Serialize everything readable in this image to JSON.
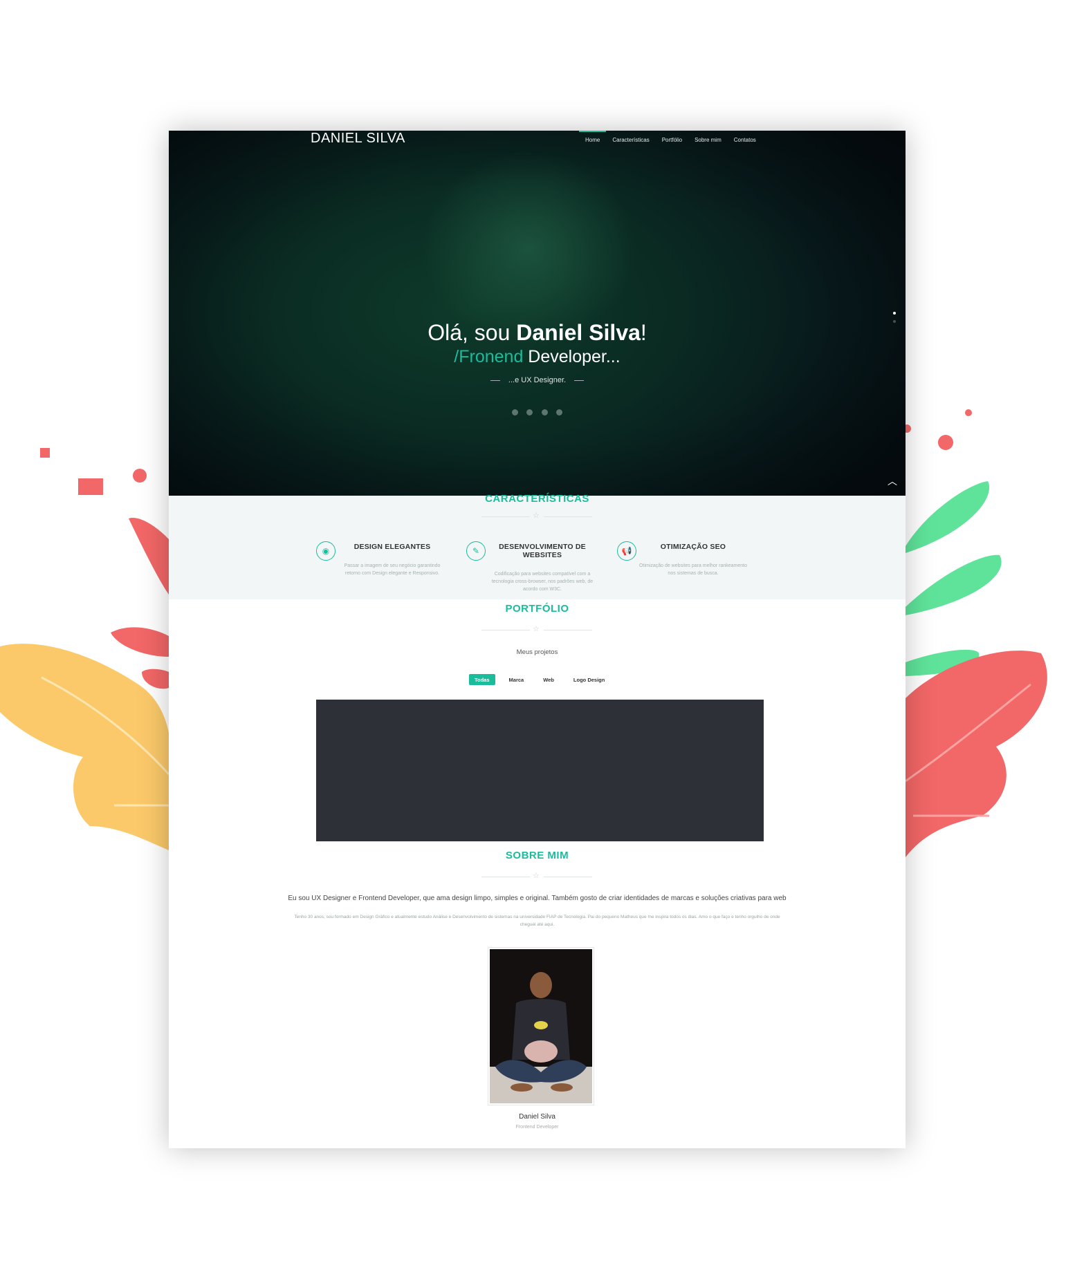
{
  "brand": "DANIEL SILVA",
  "nav": {
    "items": [
      {
        "label": "Home",
        "active": true
      },
      {
        "label": "Características",
        "active": false
      },
      {
        "label": "Portfólio",
        "active": false
      },
      {
        "label": "Sobre mim",
        "active": false
      },
      {
        "label": "Contatos",
        "active": false
      }
    ]
  },
  "hero": {
    "greeting": "Olá, sou ",
    "name": "Daniel Silva",
    "exclaim": "!",
    "role_accent": "/Fronend",
    "role_rest": " Developer...",
    "tagline": "...e UX Designer.",
    "social_icons": [
      "linkedin-icon",
      "pinterest-icon",
      "vimeo-icon",
      "twitter-icon"
    ]
  },
  "features": {
    "title": "CARACTERÍSTICAS",
    "items": [
      {
        "icon": "github-icon",
        "title": "DESIGN ELEGANTES",
        "text": "Passar a imagem de seu negócio garantindo retorno com Design elegante e Responsivo."
      },
      {
        "icon": "pencil-icon",
        "title": "DESENVOLVIMENTO DE WEBSITES",
        "text": "Codificação para websites compatível com a tecnologia cross-browser, nos padrões web, de acordo com W3C."
      },
      {
        "icon": "megaphone-icon",
        "title": "OTIMIZAÇÃO SEO",
        "text": "Otimização de websites para melhor rankeamento nos sistemas de busca."
      }
    ]
  },
  "portfolio": {
    "title": "PORTFÓLIO",
    "subtitle": "Meus projetos",
    "filters": [
      {
        "label": "Todas",
        "active": true
      },
      {
        "label": "Marca",
        "active": false
      },
      {
        "label": "Web",
        "active": false
      },
      {
        "label": "Logo Design",
        "active": false
      }
    ]
  },
  "about": {
    "title": "SOBRE MIM",
    "lead": "Eu sou UX Designer e Frontend Developer, que ama design limpo, simples e original. Também gosto de criar identidades de marcas e soluções criativas para web",
    "text": "Tenho 30 anos, sou formado em Design Gráfico e atualmente estudo Análise e Desenvolvimento de sistemas na universidade FIAP de Tecnologia. Pai do pequeno Matheus que me inspira todos os dias. Amo o que faço e tenho orgulho de onde cheguei até aqui.",
    "name": "Daniel Silva",
    "role": "Frontend Developer"
  },
  "colors": {
    "accent": "#1abc9c",
    "portfolio_box": "#2d3137",
    "deco_red": "#f26767",
    "deco_green": "#5fe39a",
    "deco_yellow": "#fbc96a"
  }
}
